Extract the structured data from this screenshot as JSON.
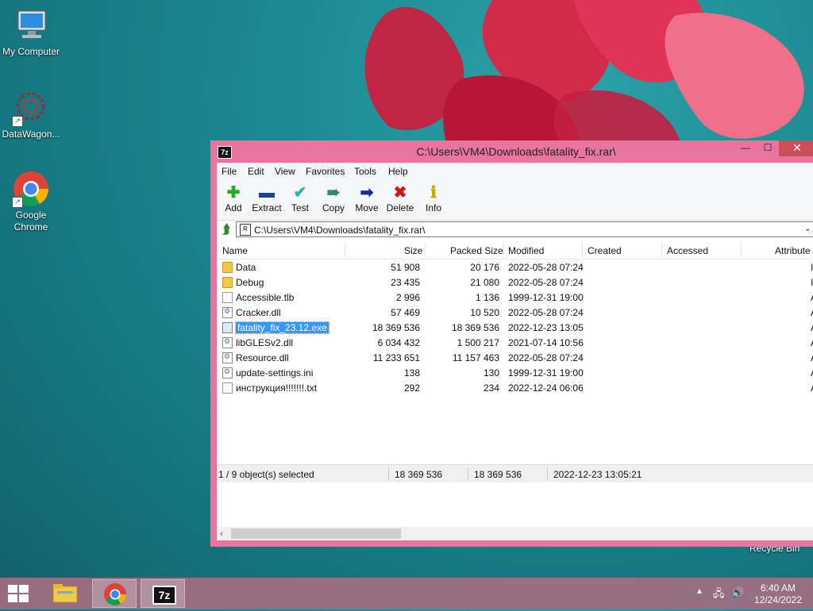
{
  "desktop": {
    "icons": [
      {
        "label": "My Computer"
      },
      {
        "label": "DataWagon..."
      },
      {
        "label": "Google Chrome"
      }
    ],
    "recycle_bin": "Recycle Bin"
  },
  "window": {
    "app_icon": "7z",
    "title": "C:\\Users\\VM4\\Downloads\\fatality_fix.rar\\",
    "controls": {
      "minimize": "—",
      "maximize": "☐",
      "close": "✕"
    }
  },
  "menu": [
    "File",
    "Edit",
    "View",
    "Favorites",
    "Tools",
    "Help"
  ],
  "toolbar": [
    {
      "label": "Add",
      "icon": "plus-icon",
      "color": "#22b022"
    },
    {
      "label": "Extract",
      "icon": "minus-icon",
      "color": "#1a3ea8"
    },
    {
      "label": "Test",
      "icon": "check-icon",
      "color": "#2ab0b8"
    },
    {
      "label": "Copy",
      "icon": "arrow-double-icon",
      "color": "#2b8a6a"
    },
    {
      "label": "Move",
      "icon": "arrow-right-icon",
      "color": "#1a2e8a"
    },
    {
      "label": "Delete",
      "icon": "x-icon",
      "color": "#d01818"
    },
    {
      "label": "Info",
      "icon": "info-icon",
      "color": "#c8a800"
    }
  ],
  "address": {
    "path": "C:\\Users\\VM4\\Downloads\\fatality_fix.rar\\"
  },
  "columns": [
    "Name",
    "Size",
    "Packed Size",
    "Modified",
    "Created",
    "Accessed",
    "Attribute"
  ],
  "files": [
    {
      "name": "Data",
      "type": "folder",
      "size": "51 908",
      "packed": "20 176",
      "modified": "2022-05-28 07:24",
      "attr": "I"
    },
    {
      "name": "Debug",
      "type": "folder",
      "size": "23 435",
      "packed": "21 080",
      "modified": "2022-05-28 07:24",
      "attr": "I"
    },
    {
      "name": "Accessible.tlb",
      "type": "file",
      "size": "2 996",
      "packed": "1 136",
      "modified": "1999-12-31 19:00",
      "attr": "A"
    },
    {
      "name": "Cracker.dll",
      "type": "dll",
      "size": "57 469",
      "packed": "10 520",
      "modified": "2022-05-28 07:24",
      "attr": "A"
    },
    {
      "name": "fatality_fix_23.12.exe",
      "type": "exe",
      "size": "18 369 536",
      "packed": "18 369 536",
      "modified": "2022-12-23 13:05",
      "attr": "A"
    },
    {
      "name": "libGLESv2.dll",
      "type": "dll",
      "size": "6 034 432",
      "packed": "1 500 217",
      "modified": "2021-07-14 10:56",
      "attr": "A"
    },
    {
      "name": "Resource.dll",
      "type": "dll",
      "size": "11 233 651",
      "packed": "11 157 463",
      "modified": "2022-05-28 07:24",
      "attr": "A"
    },
    {
      "name": "update-settings.ini",
      "type": "dll",
      "size": "138",
      "packed": "130",
      "modified": "1999-12-31 19:00",
      "attr": "A"
    },
    {
      "name": "инструкция!!!!!!!.txt",
      "type": "file",
      "size": "292",
      "packed": "234",
      "modified": "2022-12-24 06:06",
      "attr": "A"
    }
  ],
  "status": {
    "selected": "1 / 9 object(s) selected",
    "size": "18 369 536",
    "packed": "18 369 536",
    "modified": "2022-12-23 13:05:21"
  },
  "taskbar": {
    "apps": [
      "file-explorer-icon",
      "chrome-icon",
      "7zip-icon"
    ],
    "seven_zip_label": "7z",
    "time": "6:40 AM",
    "date": "12/24/2022"
  }
}
